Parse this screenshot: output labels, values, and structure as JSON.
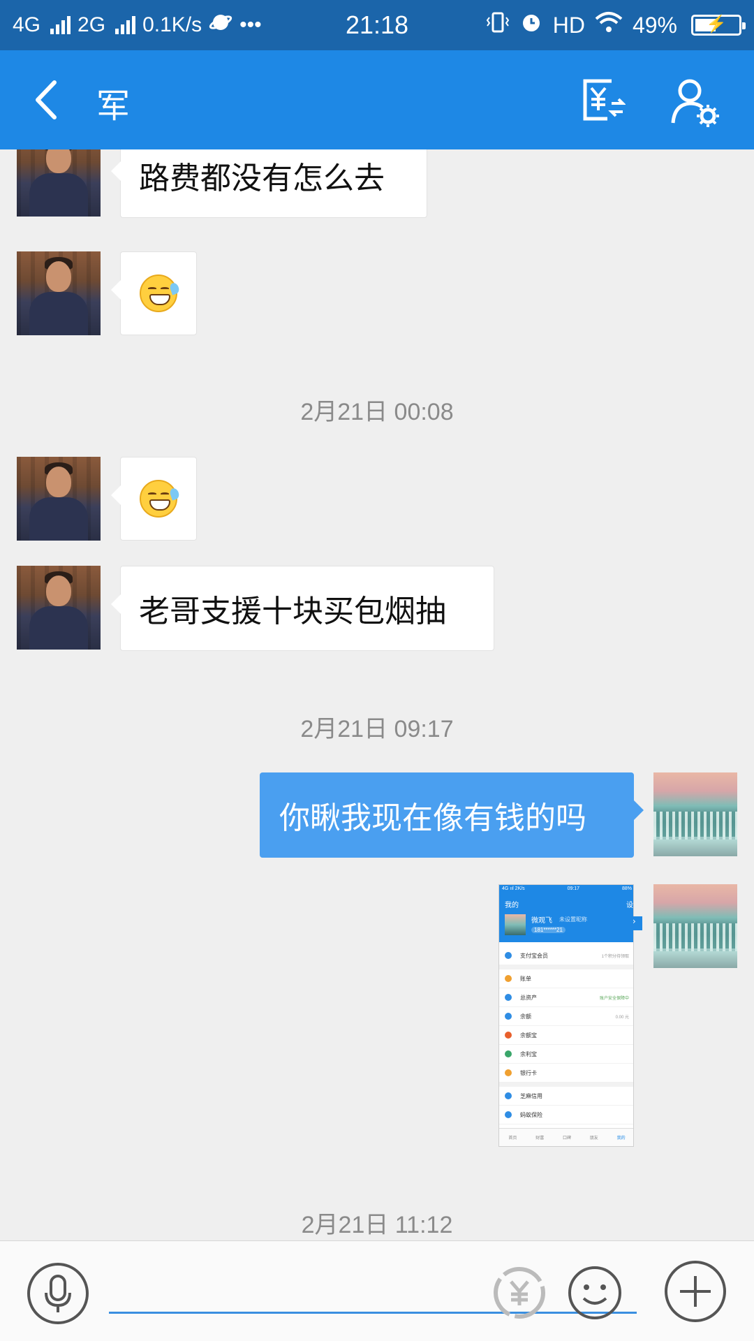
{
  "status_bar": {
    "network1": "4G",
    "network2": "2G",
    "speed": "0.1K/s",
    "more": "•••",
    "time": "21:18",
    "hd": "HD",
    "battery": "49%",
    "battery_level": 0.49
  },
  "header": {
    "title": "军",
    "back_icon": "chevron-left-icon",
    "transfer_icon": "yuan-transfer-icon",
    "settings_icon": "user-settings-icon"
  },
  "messages": [
    {
      "from": "friend",
      "type": "text",
      "text": "路费都没有怎么去"
    },
    {
      "from": "friend",
      "type": "emoji",
      "emoji": "grin-sweat"
    },
    {
      "type": "timestamp",
      "text": "2月21日 00:08"
    },
    {
      "from": "friend",
      "type": "emoji",
      "emoji": "grin-sweat"
    },
    {
      "from": "friend",
      "type": "text",
      "text": "老哥支援十块买包烟抽"
    },
    {
      "type": "timestamp",
      "text": "2月21日 09:17"
    },
    {
      "from": "me",
      "type": "text",
      "text": "你瞅我现在像有钱的吗"
    },
    {
      "from": "me",
      "type": "image",
      "image": "alipay-profile-screenshot"
    },
    {
      "type": "timestamp",
      "text": "2月21日 11:12"
    }
  ],
  "screenshot": {
    "status_left": "4G ııl 2K/s",
    "status_time": "09:17",
    "status_right": "88%",
    "title": "我的",
    "settings": "设",
    "name": "微观飞",
    "nickname": "未设置昵称",
    "phone": "181******21",
    "items": [
      {
        "label": "支付宝会员",
        "right": "1个积分待领取",
        "color": "#2f8de4"
      },
      {
        "label": "账单",
        "right": "",
        "color": "#f0a030"
      },
      {
        "label": "总资产",
        "right": "账户安全保障中",
        "color": "#2f8de4"
      },
      {
        "label": "余额",
        "right": "0.00 元",
        "color": "#2f8de4"
      },
      {
        "label": "余额宝",
        "right": "",
        "color": "#e8602c"
      },
      {
        "label": "余利宝",
        "right": "",
        "color": "#3aa66a"
      },
      {
        "label": "银行卡",
        "right": "",
        "color": "#f0a030"
      },
      {
        "label": "芝麻信用",
        "right": "",
        "color": "#2f8de4"
      },
      {
        "label": "蚂蚁保险",
        "right": "",
        "color": "#2f8de4"
      }
    ],
    "tabs": [
      "首页",
      "财富",
      "口碑",
      "朋友",
      "我的"
    ]
  },
  "input": {
    "placeholder": "",
    "mic_icon": "microphone-icon",
    "red_packet_icon": "yuan-coin-icon",
    "emoji_icon": "smiley-icon",
    "plus_icon": "plus-icon"
  },
  "colors": {
    "status_bar": "#1b65aa",
    "nav_bar": "#1e88e5",
    "outgoing_bubble": "#4a9ff0",
    "background": "#efefef"
  }
}
